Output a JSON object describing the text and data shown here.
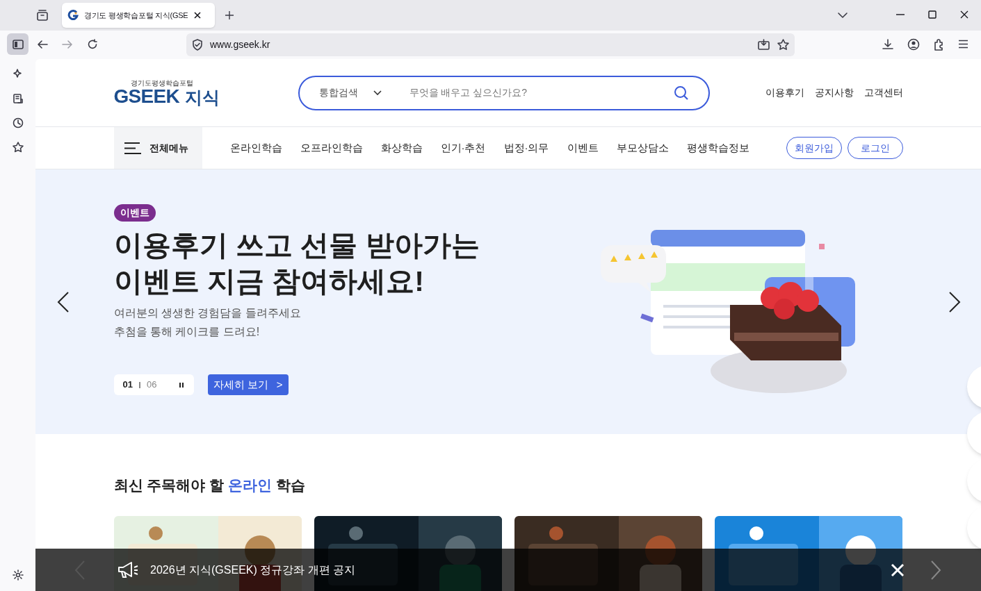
{
  "browser": {
    "tab": {
      "title": "경기도 평생학습포털 지식(GSE",
      "selected": true
    },
    "url": "www.gseek.kr"
  },
  "header": {
    "logo_caption": "경기도평생학습포털",
    "logo_main": "GSEEK",
    "logo_sub": "지식",
    "search": {
      "category": "통합검색",
      "placeholder": "무엇을 배우고 싶으신가요?"
    },
    "links": [
      "이용후기",
      "공지사항",
      "고객센터"
    ]
  },
  "nav": {
    "menu": "전체메뉴",
    "items": [
      "온라인학습",
      "오프라인학습",
      "화상학습",
      "인기·추천",
      "법정·의무",
      "이벤트",
      "부모상담소",
      "평생학습정보"
    ],
    "buttons": [
      "회원가입",
      "로그인"
    ]
  },
  "hero": {
    "badge": "이벤트",
    "title_lines": [
      "이용후기 쓰고 선물 받아가는",
      "이벤트 지금 참여하세요!"
    ],
    "desc_lines": [
      "여러분의 생생한 경험담을 들려주세요",
      "추첨을 통해 케이크를 드려요!"
    ],
    "pager": {
      "current": "01",
      "total": "06",
      "paused": false
    },
    "button": "자세히 보기",
    "button_arrow": ">"
  },
  "section": {
    "title_parts": [
      {
        "text": "최신 주목해야 할 ",
        "highlight": false
      },
      {
        "text": "온라인",
        "highlight": true
      },
      {
        "text": " 학습",
        "highlight": false
      }
    ]
  },
  "notice": {
    "text": "2026년 지식(GSEEK) 정규강좌 개편 공지"
  }
}
